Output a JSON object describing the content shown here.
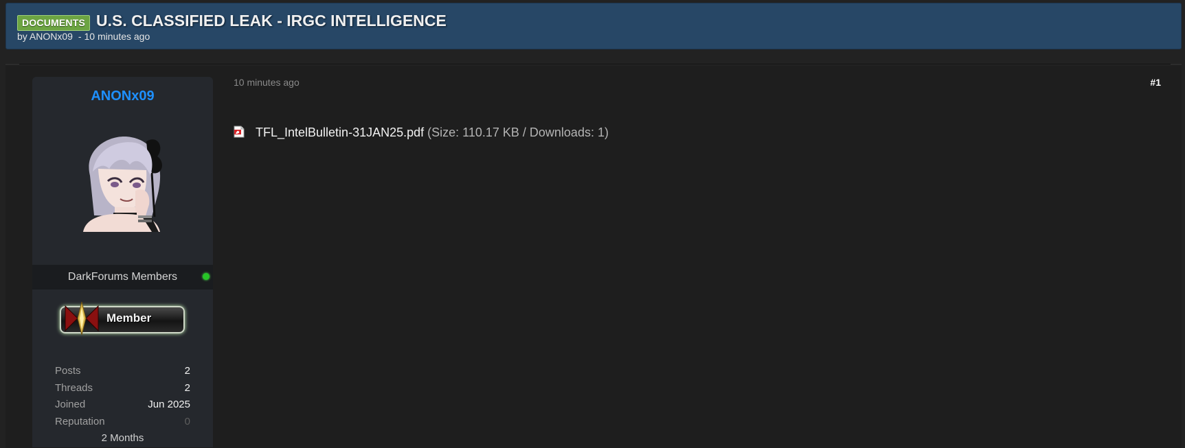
{
  "thread": {
    "prefix": "DOCUMENTS",
    "title": "U.S. CLASSIFIED LEAK - IRGC INTELLIGENCE",
    "byline_prefix": "by",
    "author": "ANONx09",
    "byline_separator": "-",
    "time_ago": "10 minutes ago"
  },
  "post": {
    "time_ago": "10 minutes ago",
    "number": "#1",
    "attachment": {
      "icon": "pdf-icon",
      "filename": "TFL_IntelBulletin-31JAN25.pdf",
      "meta": "(Size: 110.17 KB / Downloads: 1)"
    }
  },
  "author_panel": {
    "username": "ANONx09",
    "usergroup": "DarkForums Members",
    "online": true,
    "rank_badge": "Member",
    "stats": [
      {
        "label": "Posts",
        "value": "2"
      },
      {
        "label": "Threads",
        "value": "2"
      },
      {
        "label": "Joined",
        "value": "Jun 2025"
      },
      {
        "label": "Reputation",
        "value": "0"
      }
    ],
    "account_age": "2 Months"
  },
  "colors": {
    "header_bg": "#274766",
    "prefix_bg": "#6ca442",
    "username": "#1e90ff",
    "online": "#27c427",
    "page_bg": "#222222",
    "post_bg": "#1e1e1e",
    "panel_bg": "#25282d"
  }
}
